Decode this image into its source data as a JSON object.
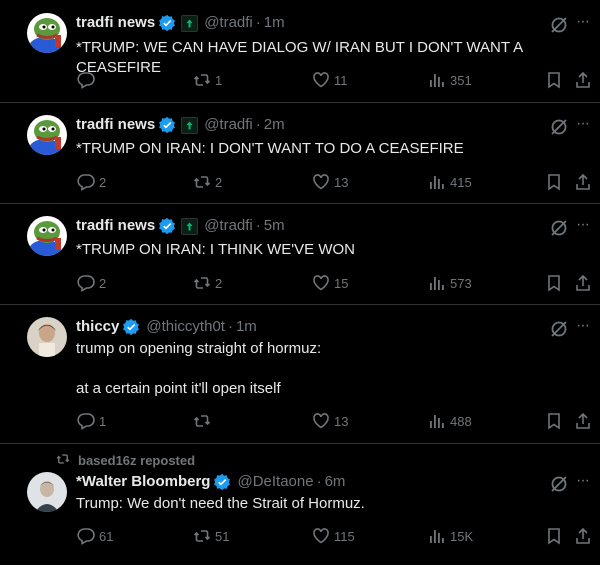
{
  "tweets": [
    {
      "name": "tradfi news",
      "handle": "@tradfi",
      "time": "1m",
      "text": "*TRUMP: WE CAN HAVE DIALOG W/ IRAN BUT I DON'T WANT A CEASEFIRE",
      "replies": "",
      "reposts": "1",
      "likes": "11",
      "views": "351"
    },
    {
      "name": "tradfi news",
      "handle": "@tradfi",
      "time": "2m",
      "text": "*TRUMP ON IRAN: I DON'T WANT TO DO A CEASEFIRE",
      "replies": "2",
      "reposts": "2",
      "likes": "13",
      "views": "415"
    },
    {
      "name": "tradfi news",
      "handle": "@tradfi",
      "time": "5m",
      "text": "*TRUMP ON IRAN: I THINK WE'VE WON",
      "replies": "2",
      "reposts": "2",
      "likes": "15",
      "views": "573"
    },
    {
      "name": "thiccy",
      "handle": "@thiccyth0t",
      "time": "1m",
      "text": "trump on opening straight of hormuz:\n\nat a certain point it'll open itself",
      "replies": "1",
      "reposts": "",
      "likes": "13",
      "views": "488"
    },
    {
      "reposted_by": "based16z reposted",
      "name": "*Walter Bloomberg",
      "handle": "@DeItaone",
      "time": "6m",
      "text": "Trump: We don't need the Strait of Hormuz.",
      "replies": "61",
      "reposts": "51",
      "likes": "115",
      "views": "15K"
    }
  ],
  "separator": "·",
  "more_glyph": "···",
  "icons": [
    "verified-badge-icon",
    "affiliate-badge-icon",
    "grok-icon",
    "more-icon",
    "reply-icon",
    "repost-icon",
    "like-icon",
    "views-icon",
    "bookmark-icon",
    "share-icon"
  ],
  "colors": {
    "background": "#000000",
    "text": "#e7e9ea",
    "muted": "#71767b",
    "verified": "#1d9bf0",
    "divider": "#2f3336"
  }
}
